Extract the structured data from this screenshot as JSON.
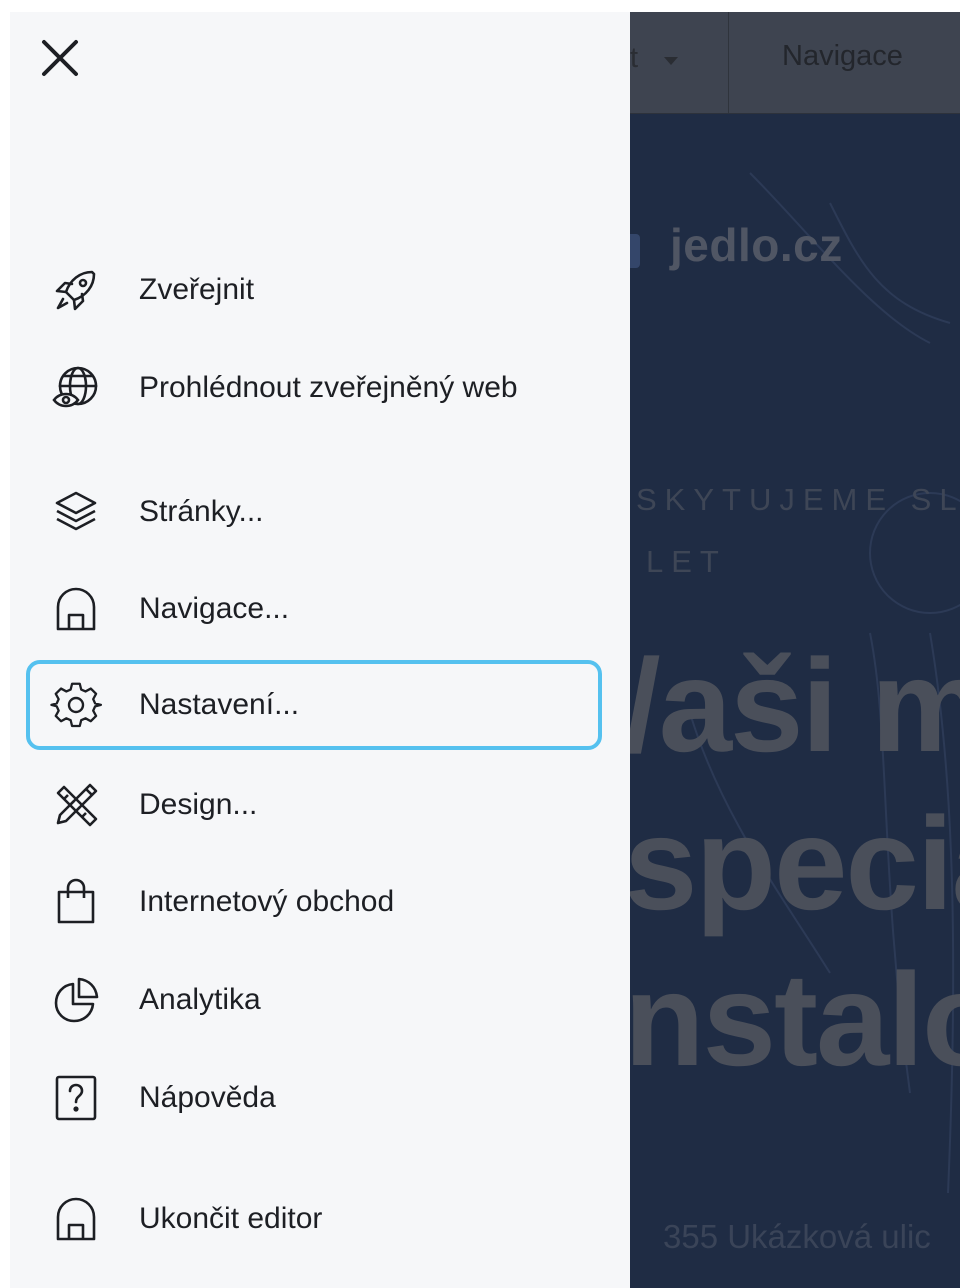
{
  "editor": {
    "dropdown_label": "t",
    "nav_label": "Navigace",
    "logo_text": "jedlo.cz",
    "eyebrow_line1": "SKYTUJEME SLU",
    "eyebrow_line2": "LET",
    "headline_line1": "/aši m",
    "headline_line2": "specia",
    "headline_line3": "nstalo",
    "address": "355 Ukázková ulic"
  },
  "menu": {
    "close_icon": "close-icon",
    "items": [
      {
        "label": "Zveřejnit",
        "icon": "rocket-icon"
      },
      {
        "label": "Prohlédnout zveřejněný web",
        "icon": "globe-eye-icon"
      },
      {
        "label": "Stránky...",
        "icon": "layers-icon"
      },
      {
        "label": "Navigace...",
        "icon": "home-icon"
      },
      {
        "label": "Nastavení...",
        "icon": "gear-icon",
        "selected": true
      },
      {
        "label": "Design...",
        "icon": "pencil-ruler-icon"
      },
      {
        "label": "Internetový obchod",
        "icon": "shopping-bag-icon"
      },
      {
        "label": "Analytika",
        "icon": "pie-chart-icon"
      },
      {
        "label": "Nápověda",
        "icon": "help-icon"
      },
      {
        "label": "Ukončit editor",
        "icon": "home-exit-icon"
      }
    ]
  },
  "colors": {
    "panel_bg": "#f6f7f9",
    "selection_border": "#55c1ef",
    "overlay_bg": "#1f2c44",
    "text": "#1d1f24"
  }
}
